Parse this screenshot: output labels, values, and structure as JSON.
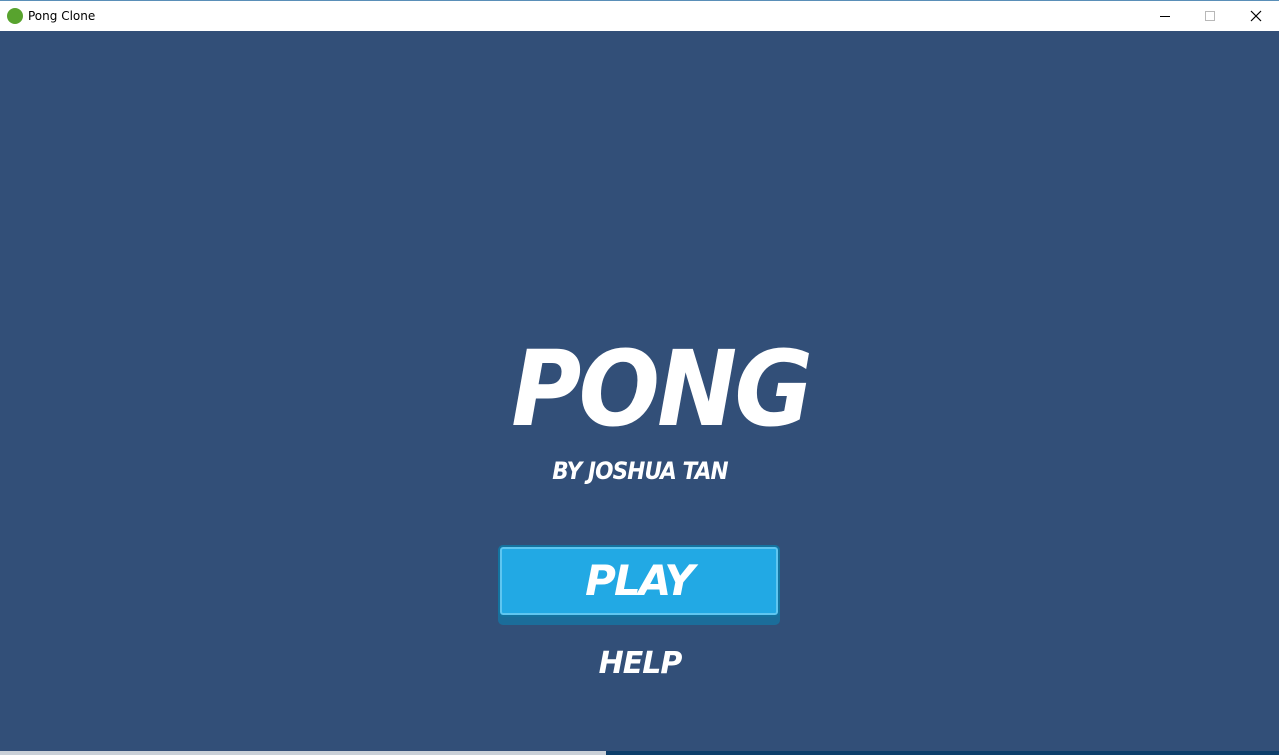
{
  "window": {
    "title": "Pong Clone",
    "icon": "app-icon",
    "controls": [
      "minimize-icon",
      "maximize-icon",
      "close-icon"
    ]
  },
  "game": {
    "title": "PONG",
    "byline": "BY JOSHUA TAN",
    "play_label": "PLAY",
    "help_label": "HELP"
  },
  "colors": {
    "background": "#324f78",
    "button": "#22a9e4",
    "button_shadow": "#1b6d9a",
    "text": "#ffffff",
    "app_icon": "#58a32e"
  }
}
